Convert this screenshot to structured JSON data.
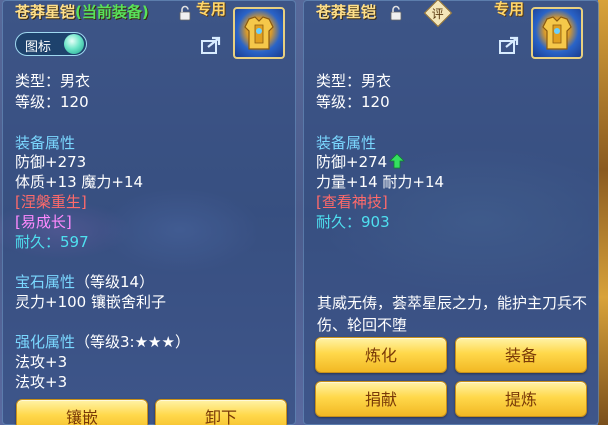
{
  "left": {
    "title": "苍莽星铠",
    "title_sub": "(当前装备)",
    "exclusive": "专用",
    "toggle_label": "图标",
    "type": "类型：男衣",
    "level": "等级：120",
    "attr_header": "装备属性",
    "defense": "防御+273",
    "stats": "体质+13 魔力+14",
    "special_1": "[涅槃重生]",
    "special_2": "[易成长]",
    "durability_label": "耐久：",
    "durability_value": "597",
    "gem_header": "宝石属性",
    "gem_level": "（等级14）",
    "gem_effect": "灵力+100 镶嵌舍利子",
    "enhance_header": "强化属性",
    "enhance_level": "（等级3:★★★）",
    "enhance_1": "法攻+3",
    "enhance_2": "法攻+3",
    "btn_inlay": "镶嵌",
    "btn_unequip": "卸下"
  },
  "right": {
    "title": "苍莽星铠",
    "exclusive": "专用",
    "badge": "评",
    "type": "类型：男衣",
    "level": "等级：120",
    "attr_header": "装备属性",
    "defense": "防御+274",
    "stats": "力量+14 耐力+14",
    "special_1": "[查看神技]",
    "durability_label": "耐久：",
    "durability_value": "903",
    "description": "其威无俦，荟萃星辰之力，能护主刀兵不伤、轮回不堕",
    "btn_refine": "炼化",
    "btn_equip": "装备",
    "btn_donate": "捐献",
    "btn_extract": "提炼"
  },
  "colors": {
    "title": "#ffe08a",
    "header": "#7bd8ff",
    "durability": "#4fe0f0",
    "special_red": "#ff6a6a",
    "special_magenta": "#ff8aff",
    "button": "#ffd84a"
  },
  "icons": [
    "lock-icon",
    "share-icon",
    "armor-item-icon",
    "upgrade-arrow-icon",
    "rating-badge-icon",
    "toggle-knob-icon"
  ]
}
